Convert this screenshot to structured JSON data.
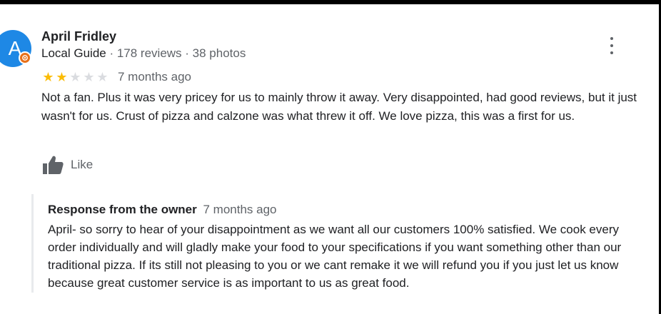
{
  "review": {
    "avatar_letter": "A",
    "avatar_color": "#1e88e5",
    "badge_icon": "local-guide-star-icon",
    "author_name": "April Fridley",
    "author_badge": "Local Guide",
    "separator": " · ",
    "review_count": "178 reviews",
    "photo_count": "38 photos",
    "rating": 2,
    "rating_max": 5,
    "time_ago": "7 months ago",
    "text": "Not a fan.  Plus it was very pricey for us to mainly throw it away.  Very disappointed, had good reviews, but it just wasn't for us.  Crust of  pizza and calzone was what threw it off.  We love pizza, this was a first for us.",
    "like_label": "Like",
    "like_icon": "thumbs-up-icon",
    "more_icon": "more-vert-icon"
  },
  "owner_response": {
    "title": "Response from the owner",
    "time_ago": "7 months ago",
    "text": "April- so sorry to hear of your disappointment as we want all our customers 100% satisfied. We cook every order individually and will gladly make your food to your specifications if you want something other than our traditional pizza. If its still not pleasing to you or we cant remake it we will refund you if you just let us know because great customer service is as important to us as great food."
  },
  "colors": {
    "star_on": "#fbbc04",
    "star_off": "#dadce0",
    "badge": "#e8711a",
    "secondary_text": "#5f6368"
  }
}
